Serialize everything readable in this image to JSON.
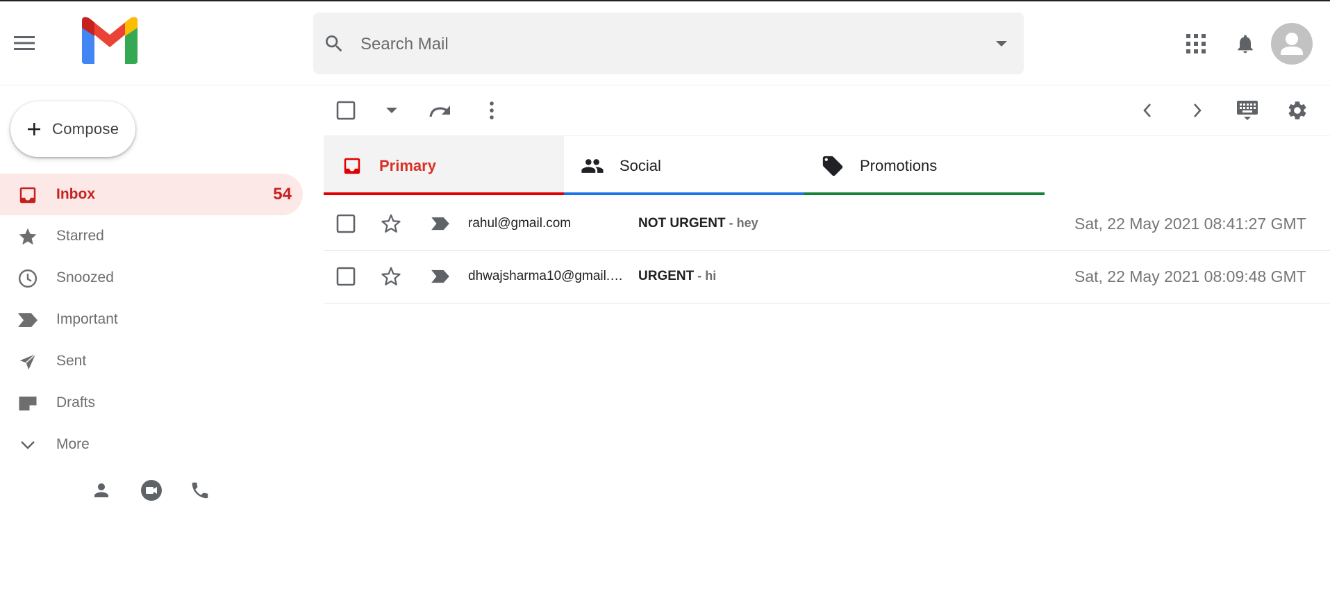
{
  "search": {
    "placeholder": "Search Mail"
  },
  "sidebar": {
    "compose_label": "Compose",
    "items": [
      {
        "name": "inbox",
        "label": "Inbox",
        "count": "54",
        "icon": "inbox-icon",
        "active": true
      },
      {
        "name": "starred",
        "label": "Starred",
        "icon": "star-icon"
      },
      {
        "name": "snoozed",
        "label": "Snoozed",
        "icon": "clock-icon"
      },
      {
        "name": "important",
        "label": "Important",
        "icon": "label-important-icon"
      },
      {
        "name": "sent",
        "label": "Sent",
        "icon": "send-icon"
      },
      {
        "name": "drafts",
        "label": "Drafts",
        "icon": "draft-icon"
      },
      {
        "name": "more",
        "label": "More",
        "icon": "chevron-down-icon"
      }
    ],
    "bottom_icons": [
      "person-icon",
      "video-call-icon",
      "phone-icon"
    ]
  },
  "tabs": [
    {
      "label": "Primary",
      "icon": "inbox-icon",
      "color": "#e00000",
      "selected": true
    },
    {
      "label": "Social",
      "icon": "people-icon",
      "color": "#1a73e8"
    },
    {
      "label": "Promotions",
      "icon": "tag-icon",
      "color": "#188038"
    }
  ],
  "mails": [
    {
      "sender": "rahul@gmail.com",
      "subject": "NOT URGENT",
      "snippet": " - hey",
      "date": "Sat, 22 May 2021 08:41:27 GMT"
    },
    {
      "sender": "dhwajsharma10@gmail.com",
      "subject": "URGENT",
      "snippet": " - hi",
      "date": "Sat, 22 May 2021 08:09:48 GMT"
    }
  ],
  "colors": {
    "accent_red": "#c5221f",
    "inbox_active_bg": "#fde8e8"
  }
}
